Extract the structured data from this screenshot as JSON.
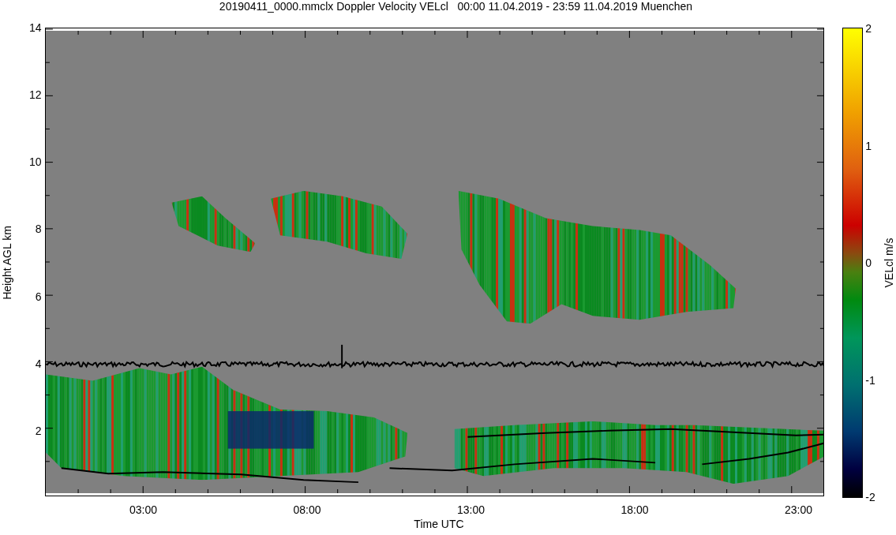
{
  "title": "20190411_0000.mmclx Doppler Velocity VELcl   00:00 11.04.2019 - 23:59 11.04.2019 Muenchen",
  "y_axis": {
    "label": "Height AGL km",
    "ticks": [
      "14",
      "12",
      "10",
      "8",
      "6",
      "4",
      "2"
    ]
  },
  "x_axis": {
    "label": "Time UTC",
    "ticks": [
      "03:00",
      "08:00",
      "13:00",
      "18:00",
      "23:00"
    ]
  },
  "colorbar": {
    "label": "VELcl m/s",
    "ticks": [
      "2",
      "1",
      "0",
      "-1",
      "-2"
    ]
  }
}
